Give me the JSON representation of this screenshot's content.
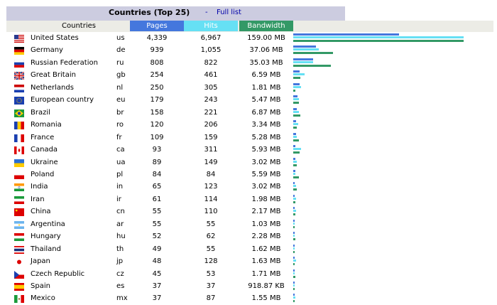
{
  "title": "Countries (Top 25)",
  "separator": "-",
  "full_list_link": "Full list",
  "headers": {
    "countries": "Countries",
    "pages": "Pages",
    "hits": "Hits",
    "bandwidth": "Bandwidth"
  },
  "colors": {
    "pages": "#4477dd",
    "hits": "#66e0f4",
    "bandwidth": "#339966",
    "title_bg": "#cccce0",
    "header_bg": "#ecece6"
  },
  "rows": [
    {
      "name": "United States",
      "code": "us",
      "pages": "4,339",
      "hits": "6,967",
      "bandwidth": "159.00 MB",
      "flag": "flag-us-icon"
    },
    {
      "name": "Germany",
      "code": "de",
      "pages": "939",
      "hits": "1,055",
      "bandwidth": "37.06 MB",
      "flag": "flag-de-icon"
    },
    {
      "name": "Russian Federation",
      "code": "ru",
      "pages": "808",
      "hits": "822",
      "bandwidth": "35.03 MB",
      "flag": "flag-ru-icon"
    },
    {
      "name": "Great Britain",
      "code": "gb",
      "pages": "254",
      "hits": "461",
      "bandwidth": "6.59 MB",
      "flag": "flag-gb-icon"
    },
    {
      "name": "Netherlands",
      "code": "nl",
      "pages": "250",
      "hits": "305",
      "bandwidth": "1.81 MB",
      "flag": "flag-nl-icon"
    },
    {
      "name": "European country",
      "code": "eu",
      "pages": "179",
      "hits": "243",
      "bandwidth": "5.47 MB",
      "flag": "flag-eu-icon"
    },
    {
      "name": "Brazil",
      "code": "br",
      "pages": "158",
      "hits": "221",
      "bandwidth": "6.87 MB",
      "flag": "flag-br-icon"
    },
    {
      "name": "Romania",
      "code": "ro",
      "pages": "120",
      "hits": "206",
      "bandwidth": "3.34 MB",
      "flag": "flag-ro-icon"
    },
    {
      "name": "France",
      "code": "fr",
      "pages": "109",
      "hits": "159",
      "bandwidth": "5.28 MB",
      "flag": "flag-fr-icon"
    },
    {
      "name": "Canada",
      "code": "ca",
      "pages": "93",
      "hits": "311",
      "bandwidth": "5.93 MB",
      "flag": "flag-ca-icon"
    },
    {
      "name": "Ukraine",
      "code": "ua",
      "pages": "89",
      "hits": "149",
      "bandwidth": "3.02 MB",
      "flag": "flag-ua-icon"
    },
    {
      "name": "Poland",
      "code": "pl",
      "pages": "84",
      "hits": "84",
      "bandwidth": "5.59 MB",
      "flag": "flag-pl-icon"
    },
    {
      "name": "India",
      "code": "in",
      "pages": "65",
      "hits": "123",
      "bandwidth": "3.02 MB",
      "flag": "flag-in-icon"
    },
    {
      "name": "Iran",
      "code": "ir",
      "pages": "61",
      "hits": "114",
      "bandwidth": "1.98 MB",
      "flag": "flag-ir-icon"
    },
    {
      "name": "China",
      "code": "cn",
      "pages": "55",
      "hits": "110",
      "bandwidth": "2.17 MB",
      "flag": "flag-cn-icon"
    },
    {
      "name": "Argentina",
      "code": "ar",
      "pages": "55",
      "hits": "55",
      "bandwidth": "1.03 MB",
      "flag": "flag-ar-icon"
    },
    {
      "name": "Hungary",
      "code": "hu",
      "pages": "52",
      "hits": "62",
      "bandwidth": "2.28 MB",
      "flag": "flag-hu-icon"
    },
    {
      "name": "Thailand",
      "code": "th",
      "pages": "49",
      "hits": "55",
      "bandwidth": "1.62 MB",
      "flag": "flag-th-icon"
    },
    {
      "name": "Japan",
      "code": "jp",
      "pages": "48",
      "hits": "128",
      "bandwidth": "1.63 MB",
      "flag": "flag-jp-icon"
    },
    {
      "name": "Czech Republic",
      "code": "cz",
      "pages": "45",
      "hits": "53",
      "bandwidth": "1.71 MB",
      "flag": "flag-cz-icon"
    },
    {
      "name": "Spain",
      "code": "es",
      "pages": "37",
      "hits": "37",
      "bandwidth": "918.87 KB",
      "flag": "flag-es-icon"
    },
    {
      "name": "Mexico",
      "code": "mx",
      "pages": "37",
      "hits": "87",
      "bandwidth": "1.55 MB",
      "flag": "flag-mx-icon"
    }
  ]
}
